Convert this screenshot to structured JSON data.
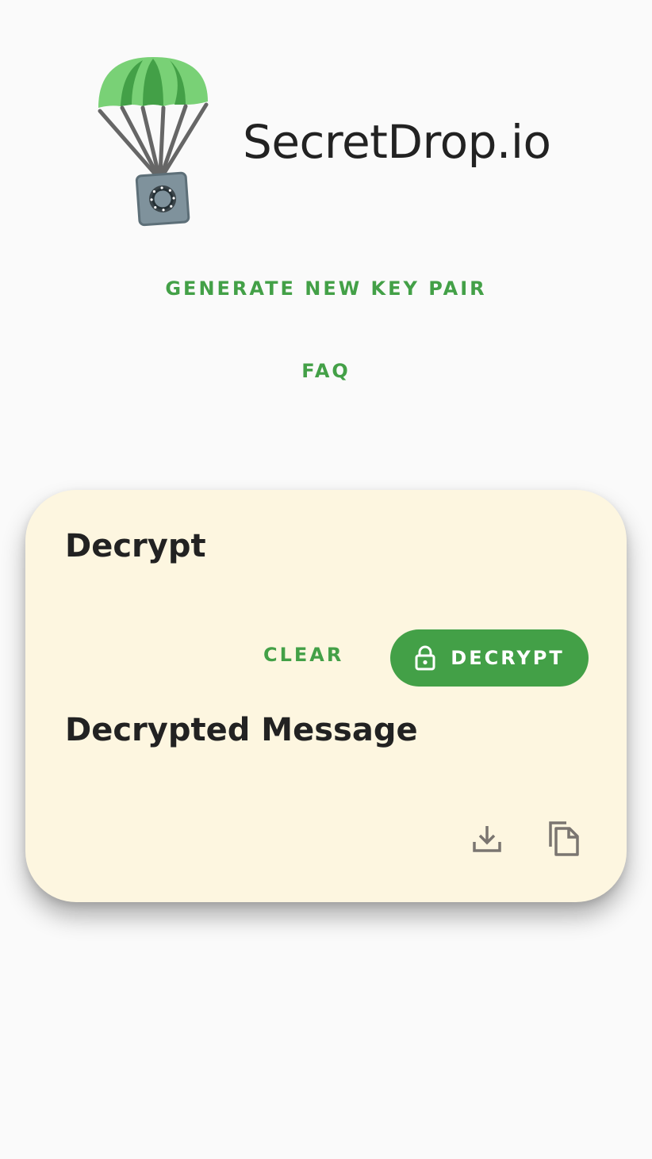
{
  "header": {
    "app_title": "SecretDrop.io",
    "logo_icon": "parachute-safe-icon"
  },
  "nav": {
    "generate_label": "GENERATE NEW KEY PAIR",
    "faq_label": "FAQ"
  },
  "decrypt_card": {
    "title": "Decrypt",
    "clear_label": "CLEAR",
    "decrypt_label": "DECRYPT",
    "decrypt_icon": "lock-icon",
    "output_title": "Decrypted Message",
    "download_icon": "download-icon",
    "copy_icon": "copy-icon"
  },
  "colors": {
    "accent": "#43a047",
    "background": "#fafafa",
    "card": "#fdf6e0",
    "text": "#222222",
    "icon": "#7a7570"
  }
}
